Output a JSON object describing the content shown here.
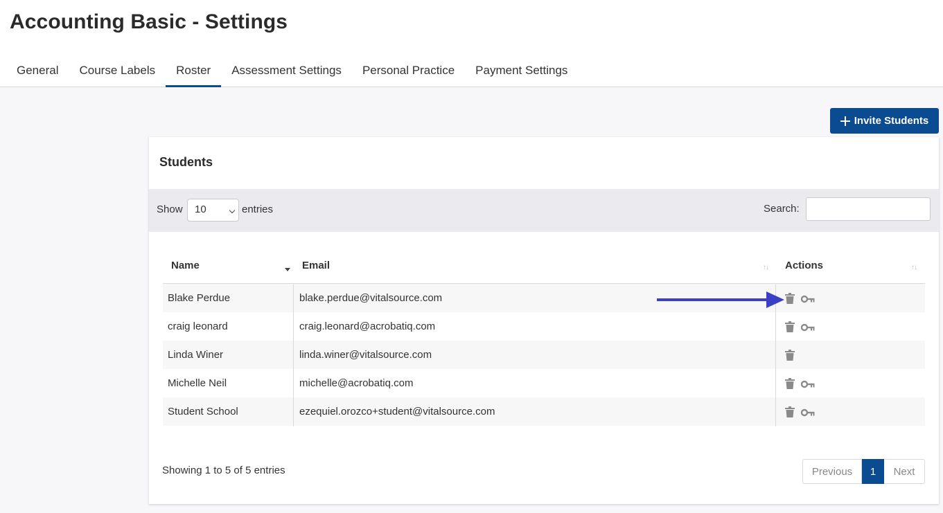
{
  "page": {
    "title": "Accounting Basic - Settings"
  },
  "tabs": [
    {
      "label": "General"
    },
    {
      "label": "Course Labels"
    },
    {
      "label": "Roster",
      "active": true
    },
    {
      "label": "Assessment Settings"
    },
    {
      "label": "Personal Practice"
    },
    {
      "label": "Payment Settings"
    }
  ],
  "invite_button": {
    "label": "Invite Students",
    "icon": "plus-icon"
  },
  "students": {
    "title": "Students",
    "show_label": "Show",
    "entries_value": "10",
    "entries_label": "entries",
    "search_label": "Search:",
    "search_value": "",
    "columns": {
      "name": "Name",
      "email": "Email",
      "actions": "Actions"
    },
    "rows": [
      {
        "name": "Blake Perdue",
        "email": "blake.perdue@vitalsource.com",
        "actions": [
          "trash-icon",
          "key-icon"
        ]
      },
      {
        "name": "craig leonard",
        "email": "craig.leonard@acrobatiq.com",
        "actions": [
          "trash-icon",
          "key-icon"
        ]
      },
      {
        "name": "Linda Winer",
        "email": "linda.winer@vitalsource.com",
        "actions": [
          "trash-icon"
        ]
      },
      {
        "name": "Michelle Neil",
        "email": "michelle@acrobatiq.com",
        "actions": [
          "trash-icon",
          "key-icon"
        ]
      },
      {
        "name": "Student School",
        "email": "ezequiel.orozco+student@vitalsource.com",
        "actions": [
          "trash-icon",
          "key-icon"
        ]
      }
    ],
    "info": "Showing 1 to 5 of 5 entries",
    "pagination": {
      "previous": "Previous",
      "current": "1",
      "next": "Next"
    }
  },
  "colors": {
    "primary": "#0b4b91",
    "annotation_arrow": "#3a3fc4",
    "icon": "#8a8a8a"
  }
}
